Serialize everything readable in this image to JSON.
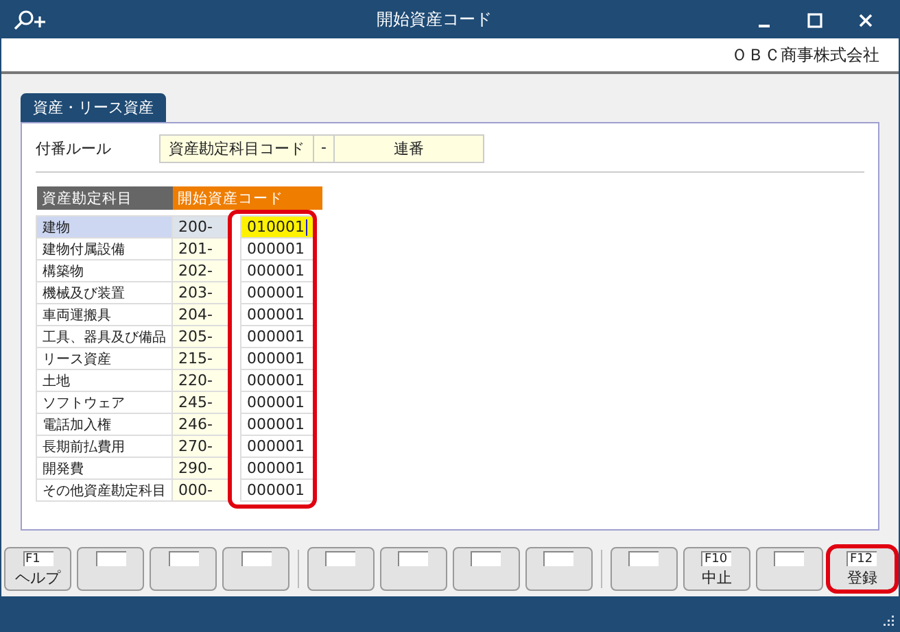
{
  "window": {
    "title": "開始資産コード"
  },
  "company": "ＯＢＣ商事株式会社",
  "tabs": [
    {
      "label": "資産・リース資産",
      "selected": true
    }
  ],
  "rule": {
    "label": "付番ルール",
    "parts": [
      "資産勘定科目コード",
      "-",
      "連番"
    ]
  },
  "table": {
    "columns": [
      "資産勘定科目",
      "開始資産コード"
    ],
    "code_column_highlighted": true,
    "rows": [
      {
        "name": "建物",
        "prefix": "200-",
        "code": "010001",
        "selected": true
      },
      {
        "name": "建物付属設備",
        "prefix": "201-",
        "code": "000001",
        "selected": false
      },
      {
        "name": "構築物",
        "prefix": "202-",
        "code": "000001",
        "selected": false
      },
      {
        "name": "機械及び装置",
        "prefix": "203-",
        "code": "000001",
        "selected": false
      },
      {
        "name": "車両運搬具",
        "prefix": "204-",
        "code": "000001",
        "selected": false
      },
      {
        "name": "工具、器具及び備品",
        "prefix": "205-",
        "code": "000001",
        "selected": false
      },
      {
        "name": "リース資産",
        "prefix": "215-",
        "code": "000001",
        "selected": false
      },
      {
        "name": "土地",
        "prefix": "220-",
        "code": "000001",
        "selected": false
      },
      {
        "name": "ソフトウェア",
        "prefix": "245-",
        "code": "000001",
        "selected": false
      },
      {
        "name": "電話加入権",
        "prefix": "246-",
        "code": "000001",
        "selected": false
      },
      {
        "name": "長期前払費用",
        "prefix": "270-",
        "code": "000001",
        "selected": false
      },
      {
        "name": "開発費",
        "prefix": "290-",
        "code": "000001",
        "selected": false
      },
      {
        "name": "その他資産勘定科目",
        "prefix": "000-",
        "code": "000001",
        "selected": false
      }
    ]
  },
  "function_keys": [
    [
      {
        "key": "F1",
        "label": "ヘルプ",
        "highlighted": false
      },
      {
        "highlighted": false
      },
      {
        "highlighted": false
      },
      {
        "highlighted": false
      }
    ],
    [
      {
        "highlighted": false
      },
      {
        "highlighted": false
      },
      {
        "highlighted": false
      },
      {
        "highlighted": false
      }
    ],
    [
      {
        "highlighted": false
      },
      {
        "key": "F10",
        "label": "中止",
        "highlighted": false
      },
      {
        "highlighted": false
      },
      {
        "key": "F12",
        "label": "登録",
        "highlighted": true
      }
    ]
  ]
}
